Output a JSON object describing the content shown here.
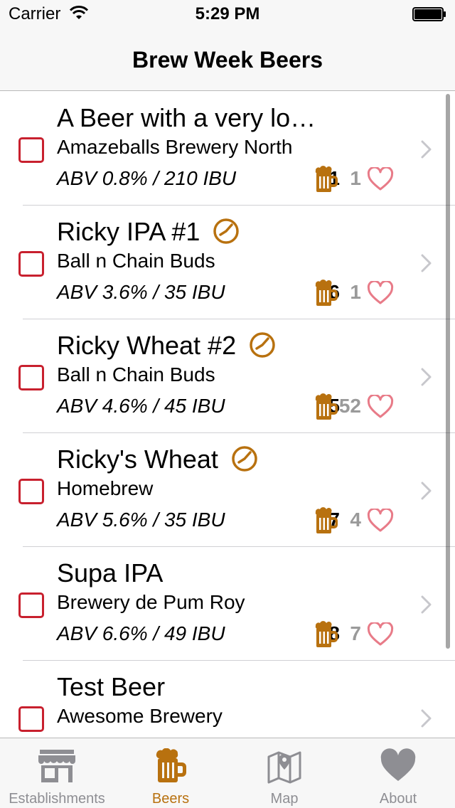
{
  "status": {
    "carrier": "Carrier",
    "time": "5:29 PM"
  },
  "nav": {
    "title": "Brew Week Beers"
  },
  "colors": {
    "accent": "#b8710f",
    "checkbox": "#c8202e",
    "heart": "#e87b88",
    "muted": "#9a9a9a"
  },
  "beers": [
    {
      "name": "A Beer with a very lo…",
      "brewery": "Amazeballs Brewery North",
      "abv": "ABV 0.8% / 210 IBU",
      "checkins": "1",
      "likes": "1",
      "clock": false
    },
    {
      "name": "Ricky IPA #1",
      "brewery": "Ball n Chain Buds",
      "abv": "ABV 3.6% / 35 IBU",
      "checkins": "6",
      "likes": "1",
      "clock": true
    },
    {
      "name": "Ricky Wheat #2",
      "brewery": "Ball n Chain Buds",
      "abv": "ABV 4.6% / 45 IBU",
      "checkins": "5",
      "likes": "52",
      "clock": true
    },
    {
      "name": "Ricky's Wheat",
      "brewery": "Homebrew",
      "abv": "ABV 5.6% / 35 IBU",
      "checkins": "7",
      "likes": "4",
      "clock": true
    },
    {
      "name": "Supa IPA",
      "brewery": "Brewery de Pum Roy",
      "abv": "ABV 6.6% / 49 IBU",
      "checkins": "8",
      "likes": "7",
      "clock": false
    },
    {
      "name": "Test Beer",
      "brewery": "Awesome Brewery",
      "abv": "",
      "checkins": "",
      "likes": "",
      "clock": false
    }
  ],
  "tabs": [
    {
      "label": "Establishments",
      "icon": "storefront-icon",
      "active": false
    },
    {
      "label": "Beers",
      "icon": "beer-mug-icon",
      "active": true
    },
    {
      "label": "Map",
      "icon": "map-icon",
      "active": false
    },
    {
      "label": "About",
      "icon": "heart-icon",
      "active": false
    }
  ]
}
